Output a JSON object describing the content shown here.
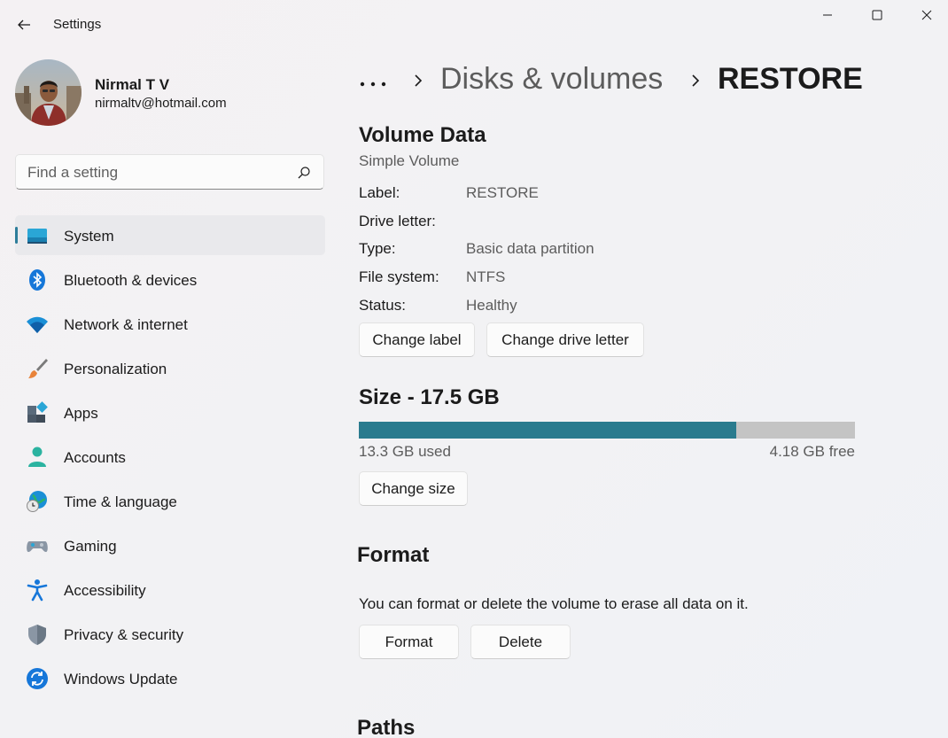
{
  "window": {
    "title": "Settings",
    "back_icon": "back-arrow-icon",
    "controls": [
      "minimize-icon",
      "maximize-icon",
      "close-icon"
    ]
  },
  "profile": {
    "name": "Nirmal T V",
    "email": "nirmaltv@hotmail.com"
  },
  "search": {
    "placeholder": "Find a setting",
    "value": ""
  },
  "nav": {
    "items": [
      {
        "label": "System",
        "icon": "system-icon",
        "selected": true
      },
      {
        "label": "Bluetooth & devices",
        "icon": "bluetooth-icon"
      },
      {
        "label": "Network & internet",
        "icon": "wifi-icon"
      },
      {
        "label": "Personalization",
        "icon": "brush-icon"
      },
      {
        "label": "Apps",
        "icon": "apps-icon"
      },
      {
        "label": "Accounts",
        "icon": "accounts-icon"
      },
      {
        "label": "Time & language",
        "icon": "globe-clock-icon"
      },
      {
        "label": "Gaming",
        "icon": "gamepad-icon"
      },
      {
        "label": "Accessibility",
        "icon": "accessibility-icon"
      },
      {
        "label": "Privacy & security",
        "icon": "shield-icon"
      },
      {
        "label": "Windows Update",
        "icon": "update-icon"
      }
    ]
  },
  "breadcrumb": {
    "more": "•••",
    "parent": "Disks & volumes",
    "current": "RESTORE"
  },
  "volume_data": {
    "title": "Volume Data",
    "subtitle": "Simple Volume",
    "properties": [
      {
        "label": "Label:",
        "value": "RESTORE"
      },
      {
        "label": "Drive letter:",
        "value": ""
      },
      {
        "label": "Type:",
        "value": "Basic data partition"
      },
      {
        "label": "File system:",
        "value": "NTFS"
      },
      {
        "label": "Status:",
        "value": "Healthy"
      }
    ],
    "change_label_button": "Change label",
    "change_drive_letter_button": "Change drive letter"
  },
  "size": {
    "title": "Size - 17.5 GB",
    "used": "13.3 GB used",
    "free": "4.18 GB free",
    "used_fraction": 0.76,
    "change_size_button": "Change size"
  },
  "format": {
    "title": "Format",
    "description": "You can format or delete the volume to erase all data on it.",
    "format_button": "Format",
    "delete_button": "Delete"
  },
  "paths": {
    "title": "Paths"
  },
  "colors": {
    "accent": "#2a7b8e",
    "bar_free": "#c4c4c4"
  }
}
